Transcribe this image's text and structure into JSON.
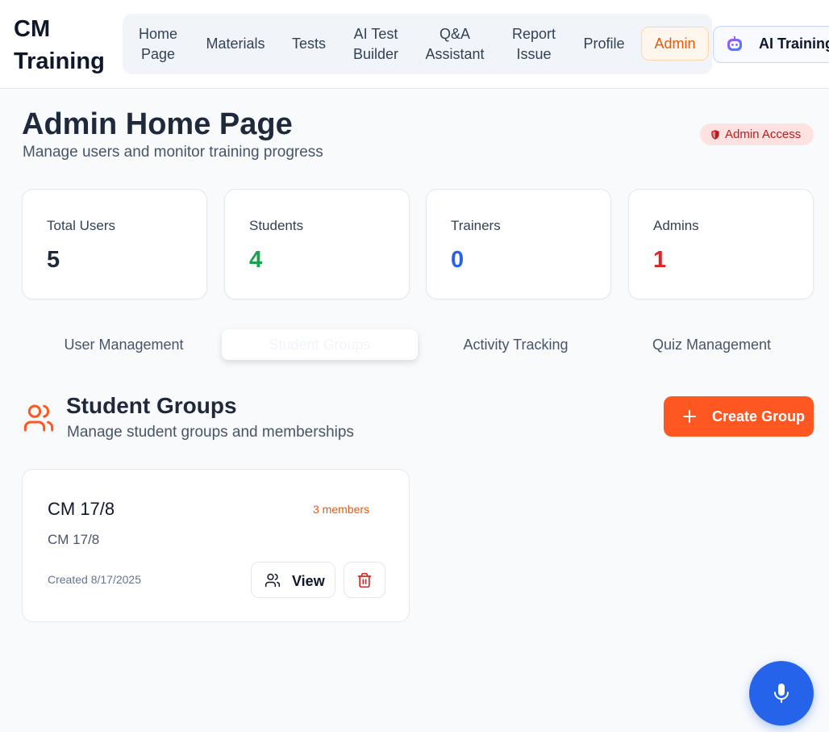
{
  "brand": {
    "line1": "CM",
    "line2": "Training"
  },
  "nav": [
    {
      "line1": "Home",
      "line2": "Page"
    },
    {
      "line1": "Materials",
      "line2": ""
    },
    {
      "line1": "Tests",
      "line2": ""
    },
    {
      "line1": "AI Test",
      "line2": "Builder"
    },
    {
      "line1": "Q&A",
      "line2": "Assistant"
    },
    {
      "line1": "Report",
      "line2": "Issue"
    },
    {
      "line1": "Profile",
      "line2": ""
    },
    {
      "line1": "Admin",
      "line2": ""
    }
  ],
  "ai_button": {
    "label": "AI Training",
    "icon": "robot-icon"
  },
  "page": {
    "title": "Admin Home Page",
    "subtitle": "Manage users and monitor training progress",
    "badge": "Admin Access"
  },
  "stats": [
    {
      "label": "Total Users",
      "value": "5",
      "color": "#1e293b"
    },
    {
      "label": "Students",
      "value": "4",
      "color": "#16a34a"
    },
    {
      "label": "Trainers",
      "value": "0",
      "color": "#2563eb"
    },
    {
      "label": "Admins",
      "value": "1",
      "color": "#dc2626"
    }
  ],
  "tabs": [
    {
      "label": "User Management"
    },
    {
      "label": "Student Groups"
    },
    {
      "label": "Activity Tracking"
    },
    {
      "label": "Quiz Management"
    }
  ],
  "active_tab": "Student Groups",
  "section": {
    "title": "Student Groups",
    "subtitle": "Manage student groups and memberships",
    "create_label": "Create Group"
  },
  "groups": [
    {
      "name": "CM 17/8",
      "members": "3 members",
      "description": "CM 17/8",
      "created": "Created 8/17/2025",
      "view_label": "View"
    }
  ],
  "colors": {
    "accent": "#ff5722",
    "admin_orange": "#ea580c",
    "mic_blue": "#2563eb"
  }
}
